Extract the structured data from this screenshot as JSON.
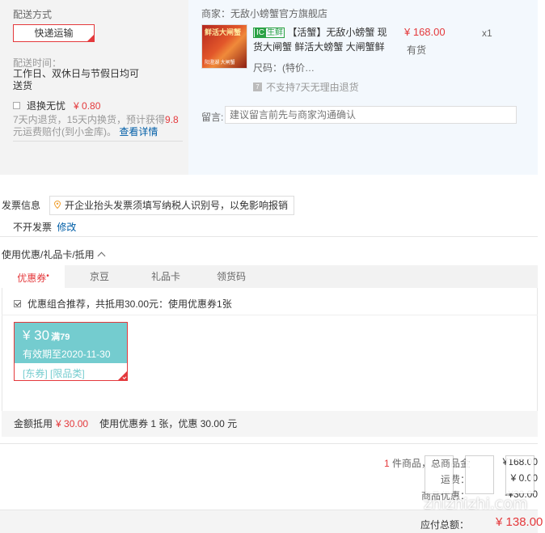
{
  "shipping": {
    "method_label": "配送方式",
    "method_value": "快递运输",
    "time_label": "配送时间：",
    "time_value": "工作日、双休日与节假日均可送货",
    "return_label": "退换无忧",
    "return_price": "¥ 0.80",
    "return_note_a": "7天内退货，15天内换货，预计获得",
    "return_note_points": "9.8",
    "return_note_b": "元运费赔付(到小金库)。",
    "return_detail_link": "查看详情"
  },
  "shop": {
    "name": "商家：无敌小螃蟹官方旗舰店",
    "image_label": "鲜活大闸蟹",
    "image_caption": "阳澄湖 大闸蟹"
  },
  "product": {
    "tag_icon": "IC",
    "tag_text": "生鲜",
    "name": "【活蟹】无敌小螃蟹 现货大闸蟹 鲜活大螃蟹 大闸蟹鲜",
    "size": "尺码：(特价…",
    "no_return": "不支持7天无理由退货",
    "price": "¥ 168.00",
    "stock": "有货",
    "qty": "x1"
  },
  "message": {
    "label": "留言:",
    "placeholder": "建议留言前先与商家沟通确认"
  },
  "invoice": {
    "title": "发票信息",
    "tip": "开企业抬头发票须填写纳税人识别号，以免影响报销",
    "value": "不开发票",
    "edit_link": "修改"
  },
  "coupons": {
    "title": "使用优惠/礼品卡/抵用",
    "tabs": [
      {
        "label": "优惠券",
        "marker": "•"
      },
      {
        "label": "京豆"
      },
      {
        "label": "礼品卡"
      },
      {
        "label": "领货码"
      }
    ],
    "combo_text": "优惠组合推荐，共抵用30.00元：使用优惠券1张",
    "card": {
      "amount": "¥ 30",
      "threshold": "满79",
      "expiry": "有效期至2020-11-30",
      "tags": "[东券] [限品类]"
    },
    "summary_label": "金额抵用",
    "summary_amount": "¥ 30.00",
    "summary_text": "使用优惠券 1 张，优惠 30.00 元"
  },
  "totals": {
    "items_count": "1",
    "items_label": "件商品，总商品金",
    "items_value": "¥168.00",
    "row2_label": "运费：",
    "row2_value": "¥ 0.00",
    "row3_label": "商品优惠：",
    "row3_value": "-¥30.00",
    "due_label": "应付总额：",
    "due_value": "¥ 138.00"
  },
  "watermark": {
    "text": "zhizhizhi.com"
  },
  "colors": {
    "accent": "#e4393c",
    "link": "#005ea7",
    "coupon_teal": "#74cccf",
    "fresh_green": "#2ba245"
  }
}
